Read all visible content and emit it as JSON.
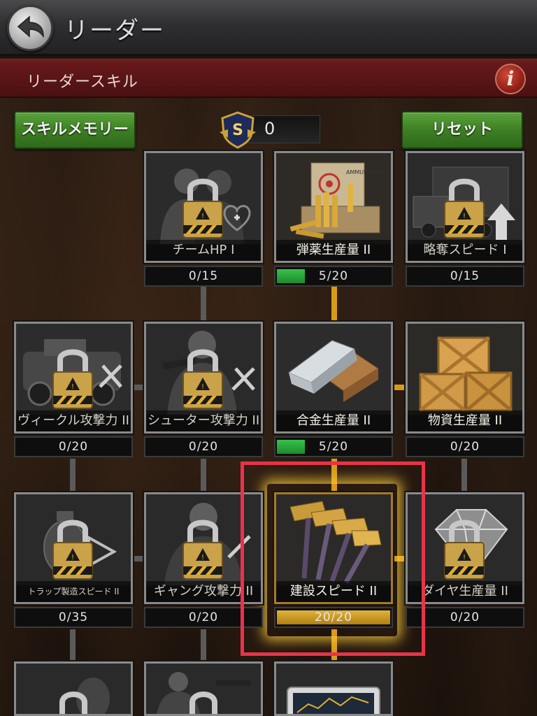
{
  "header": {
    "title": "リーダー",
    "section_title": "リーダースキル",
    "info_label": "i"
  },
  "controls": {
    "skill_memory_label": "スキルメモリー",
    "reset_label": "リセット",
    "points_badge_letter": "S",
    "points_value": "0"
  },
  "colors": {
    "locked_progress": "#0e0e0e",
    "progress_green": "#2aa83c",
    "progress_gold": "#c8961e",
    "highlight": "#e8334a",
    "active_connector": "#d89a1a"
  },
  "skills": [
    {
      "name": "チームHP I",
      "progress": "0/15",
      "current": 0,
      "max": 15,
      "locked": true,
      "icon": "team-hp-icon"
    },
    {
      "name": "弾薬生産量 II",
      "progress": "5/20",
      "current": 5,
      "max": 20,
      "locked": false,
      "icon": "ammo-icon"
    },
    {
      "name": "略奪スピード I",
      "progress": "0/15",
      "current": 0,
      "max": 15,
      "locked": true,
      "icon": "truck-icon"
    },
    {
      "name": "ヴィークル攻撃力 II",
      "progress": "0/20",
      "current": 0,
      "max": 20,
      "locked": true,
      "icon": "vehicle-icon"
    },
    {
      "name": "シューター攻撃力 II",
      "progress": "0/20",
      "current": 0,
      "max": 20,
      "locked": true,
      "icon": "shooter-icon"
    },
    {
      "name": "合金生産量 II",
      "progress": "5/20",
      "current": 5,
      "max": 20,
      "locked": false,
      "icon": "alloy-ingot-icon"
    },
    {
      "name": "物資生産量 II",
      "progress": "0/20",
      "current": 0,
      "max": 20,
      "locked": false,
      "icon": "supply-crate-icon"
    },
    {
      "name": "トラップ製造スピード II",
      "progress": "0/35",
      "current": 0,
      "max": 35,
      "locked": true,
      "icon": "trap-icon"
    },
    {
      "name": "ギャング攻撃力 II",
      "progress": "0/20",
      "current": 0,
      "max": 20,
      "locked": true,
      "icon": "gang-icon"
    },
    {
      "name": "建設スピード II",
      "progress": "20/20",
      "current": 20,
      "max": 20,
      "locked": false,
      "icon": "hammer-icon"
    },
    {
      "name": "ダイヤ生産量 II",
      "progress": "0/20",
      "current": 0,
      "max": 20,
      "locked": true,
      "icon": "diamond-icon"
    }
  ]
}
